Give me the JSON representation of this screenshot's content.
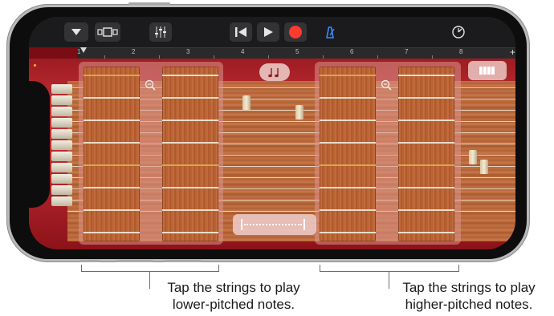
{
  "controlbar": {
    "icons": [
      "chevron-down-icon",
      "view-switch-icon",
      "mixer-icon",
      "rewind-icon",
      "play-icon",
      "record-icon",
      "metronome-icon",
      "settings-icon"
    ],
    "record_color": "#ff3b30",
    "metronome_color": "#3a8dff"
  },
  "ruler": {
    "marks": [
      "1",
      "2",
      "3",
      "4",
      "5",
      "6",
      "7",
      "8"
    ],
    "add_label": "+"
  },
  "instrument": {
    "notes_button_icon": "music-notes-icon",
    "keys_button_icon": "keys-icon",
    "zoom_icon": "zoom-out-icon",
    "slider_icon": "string-slider-icon",
    "accent_color": "#b5262d"
  },
  "callouts": {
    "left": {
      "line1": "Tap the strings to play",
      "line2": "lower-pitched notes."
    },
    "right": {
      "line1": "Tap the strings to play",
      "line2": "higher-pitched notes."
    }
  }
}
